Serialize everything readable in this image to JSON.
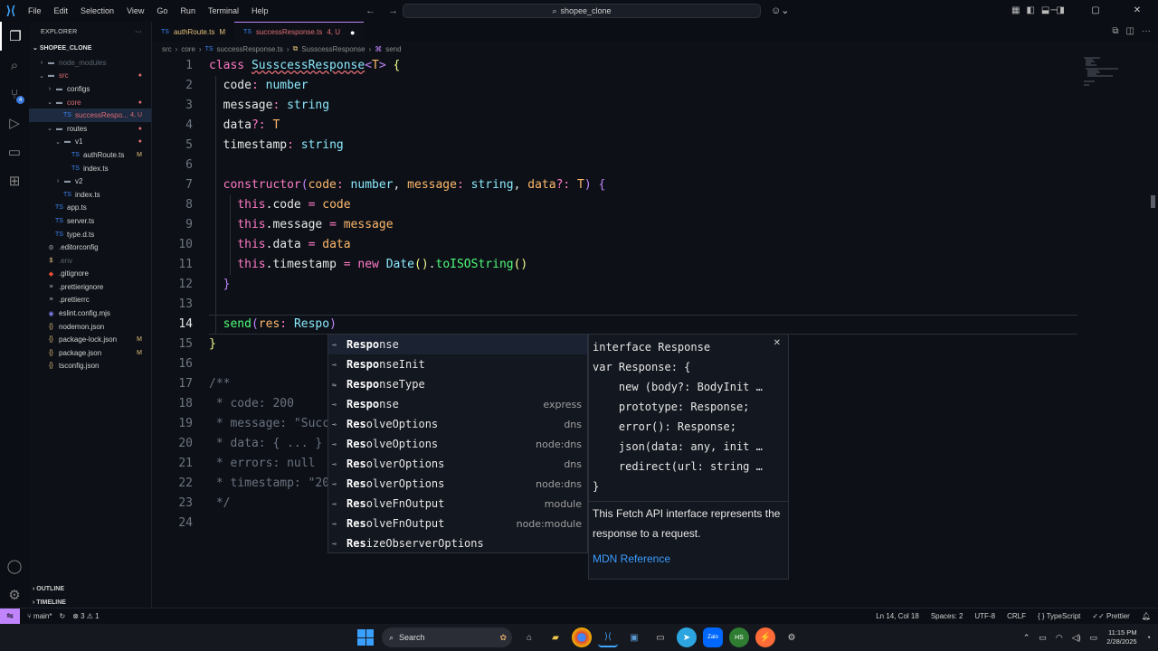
{
  "titlebar": {
    "menus": [
      "File",
      "Edit",
      "Selection",
      "View",
      "Go",
      "Run",
      "Terminal",
      "Help"
    ],
    "command_center": "shopee_clone"
  },
  "activity": {
    "scm_badge": "4"
  },
  "sidebar": {
    "title": "EXPLORER",
    "more": "···",
    "root": "SHOPEE_CLONE",
    "items": [
      {
        "label": "node_modules",
        "indent": 1,
        "kind": "folder",
        "chev": "›",
        "color": "#5c6370",
        "status": ""
      },
      {
        "label": "src",
        "indent": 1,
        "kind": "folder",
        "chev": "⌄",
        "color": "#e06c75",
        "status": "●"
      },
      {
        "label": "configs",
        "indent": 2,
        "kind": "folder",
        "chev": "›",
        "color": "#d0d0d0",
        "status": ""
      },
      {
        "label": "core",
        "indent": 2,
        "kind": "folder",
        "chev": "⌄",
        "color": "#e06c75",
        "status": "●"
      },
      {
        "label": "successRespo...",
        "indent": 3,
        "kind": "ts",
        "chev": "",
        "color": "#e06c75",
        "status": "4, U",
        "selected": true
      },
      {
        "label": "routes",
        "indent": 2,
        "kind": "folder",
        "chev": "⌄",
        "color": "#d0d0d0",
        "status": "●"
      },
      {
        "label": "v1",
        "indent": 3,
        "kind": "folder",
        "chev": "⌄",
        "color": "#d0d0d0",
        "status": "●"
      },
      {
        "label": "authRoute.ts",
        "indent": 4,
        "kind": "ts",
        "chev": "",
        "color": "#d0d0d0",
        "status": "M"
      },
      {
        "label": "index.ts",
        "indent": 4,
        "kind": "ts",
        "chev": "",
        "color": "#d0d0d0",
        "status": ""
      },
      {
        "label": "v2",
        "indent": 3,
        "kind": "folder",
        "chev": "›",
        "color": "#d0d0d0",
        "status": ""
      },
      {
        "label": "index.ts",
        "indent": 3,
        "kind": "ts",
        "chev": "",
        "color": "#d0d0d0",
        "status": ""
      },
      {
        "label": "app.ts",
        "indent": 2,
        "kind": "ts",
        "chev": "",
        "color": "#d0d0d0",
        "status": ""
      },
      {
        "label": "server.ts",
        "indent": 2,
        "kind": "ts",
        "chev": "",
        "color": "#d0d0d0",
        "status": ""
      },
      {
        "label": "type.d.ts",
        "indent": 2,
        "kind": "ts",
        "chev": "",
        "color": "#d0d0d0",
        "status": ""
      },
      {
        "label": ".editorconfig",
        "indent": 1,
        "kind": "gear",
        "chev": "",
        "color": "#d0d0d0",
        "status": ""
      },
      {
        "label": ".env",
        "indent": 1,
        "kind": "env",
        "chev": "",
        "color": "#5c6370",
        "status": ""
      },
      {
        "label": ".gitignore",
        "indent": 1,
        "kind": "git",
        "chev": "",
        "color": "#d0d0d0",
        "status": ""
      },
      {
        "label": ".prettierignore",
        "indent": 1,
        "kind": "file",
        "chev": "",
        "color": "#d0d0d0",
        "status": ""
      },
      {
        "label": ".prettierrc",
        "indent": 1,
        "kind": "file",
        "chev": "",
        "color": "#d0d0d0",
        "status": ""
      },
      {
        "label": "eslint.config.mjs",
        "indent": 1,
        "kind": "js",
        "chev": "",
        "color": "#d0d0d0",
        "status": ""
      },
      {
        "label": "nodemon.json",
        "indent": 1,
        "kind": "json",
        "chev": "",
        "color": "#d0d0d0",
        "status": ""
      },
      {
        "label": "package-lock.json",
        "indent": 1,
        "kind": "json",
        "chev": "",
        "color": "#d0d0d0",
        "status": "M"
      },
      {
        "label": "package.json",
        "indent": 1,
        "kind": "json",
        "chev": "",
        "color": "#d0d0d0",
        "status": "M"
      },
      {
        "label": "tsconfig.json",
        "indent": 1,
        "kind": "json",
        "chev": "",
        "color": "#d0d0d0",
        "status": ""
      }
    ],
    "outline": "OUTLINE",
    "timeline": "TIMELINE"
  },
  "tabs": [
    {
      "label": "authRoute.ts",
      "mark": "M",
      "active": false
    },
    {
      "label": "successResponse.ts",
      "mark": "4, U",
      "active": true
    }
  ],
  "breadcrumb": [
    "src",
    "core",
    "successResponse.ts",
    "SusscessResponse",
    "send"
  ],
  "code": {
    "line_numbers": [
      "1",
      "2",
      "3",
      "4",
      "5",
      "6",
      "7",
      "8",
      "9",
      "10",
      "11",
      "12",
      "13",
      "14",
      "15",
      "16",
      "17",
      "18",
      "19",
      "20",
      "21",
      "22",
      "23",
      "24"
    ]
  },
  "suggest": {
    "items": [
      {
        "pre": "Respo",
        "rest": "nse",
        "detail": "",
        "icon": "⊸"
      },
      {
        "pre": "Respo",
        "rest": "nseInit",
        "detail": "",
        "icon": "⊸"
      },
      {
        "pre": "Respo",
        "rest": "nseType",
        "detail": "",
        "icon": "⇋"
      },
      {
        "pre": "Respo",
        "rest": "nse",
        "detail": "express",
        "icon": "⊸"
      },
      {
        "pre": "Res",
        "rest": "olveOptions",
        "detail": "dns",
        "icon": "⊸"
      },
      {
        "pre": "Res",
        "rest": "olveOptions",
        "detail": "node:dns",
        "icon": "⊸"
      },
      {
        "pre": "Res",
        "rest": "olverOptions",
        "detail": "dns",
        "icon": "⊸"
      },
      {
        "pre": "Res",
        "rest": "olverOptions",
        "detail": "node:dns",
        "icon": "⊸"
      },
      {
        "pre": "Res",
        "rest": "olveFnOutput",
        "detail": "module",
        "icon": "⊸"
      },
      {
        "pre": "Res",
        "rest": "olveFnOutput",
        "detail": "node:module",
        "icon": "⊸"
      },
      {
        "pre": "Res",
        "rest": "izeObserverOptions",
        "detail": "",
        "icon": "⊸"
      }
    ],
    "doc": {
      "signature": "interface Response\nvar Response: {\n    new (body?: BodyInit …\n    prototype: Response;\n    error(): Response;\n    json(data: any, init …\n    redirect(url: string …\n}",
      "description": "This Fetch API interface represents the response to a request.",
      "link": "MDN Reference"
    }
  },
  "statusbar": {
    "branch": "main*",
    "problems": "⊗ 3 ⚠ 1",
    "position": "Ln 14, Col 18",
    "spaces": "Spaces: 2",
    "encoding": "UTF-8",
    "eol": "CRLF",
    "language": "TypeScript",
    "formatter": "Prettier"
  },
  "taskbar": {
    "search": "Search",
    "time": "11:15 PM",
    "date": "2/28/2025"
  },
  "colors": {
    "accent": "#c084fc",
    "selection": "#1d2a3f",
    "link": "#3b9cff"
  }
}
